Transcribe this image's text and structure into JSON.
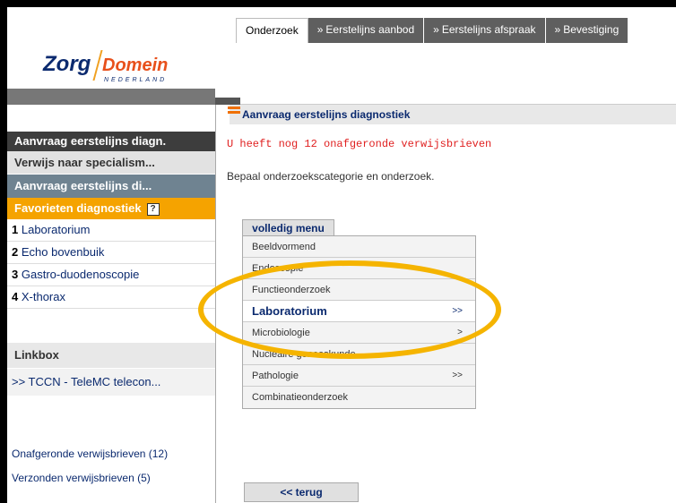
{
  "tabs": [
    {
      "label": "Onderzoek",
      "sep": ""
    },
    {
      "label": "Eerstelijns aanbod",
      "sep": "»"
    },
    {
      "label": "Eerstelijns afspraak",
      "sep": "»"
    },
    {
      "label": "Bevestiging",
      "sep": "»"
    }
  ],
  "logo": {
    "zorg": "Zorg",
    "domein": "Domein",
    "sub": "NEDERLAND"
  },
  "sidebar": {
    "header": "Aanvraag eerstelijns diagn.",
    "nav1": "Verwijs naar specialism...",
    "nav2": "Aanvraag eerstelijns di...",
    "favorites": {
      "label": "Favorieten diagnostiek",
      "help": "?"
    },
    "fav_items": [
      {
        "num": "1",
        "label": "Laboratorium"
      },
      {
        "num": "2",
        "label": "Echo bovenbuik"
      },
      {
        "num": "3",
        "label": "Gastro-duodenoscopie"
      },
      {
        "num": "4",
        "label": "X-thorax"
      }
    ],
    "linkbox_title": "Linkbox",
    "linkbox_item": ">> TCCN - TeleMC telecon...",
    "link_unfinished": "Onafgeronde verwijsbrieven (12)",
    "link_sent": "Verzonden verwijsbrieven (5)"
  },
  "main": {
    "title": "Aanvraag eerstelijns diagnostiek",
    "warning": "U heeft nog 12 onafgeronde verwijsbrieven",
    "instruction": "Bepaal onderzoekscategorie en onderzoek.",
    "menu_tab": "volledig menu",
    "menu_items": [
      {
        "label": "Beeldvormend",
        "arrow": ""
      },
      {
        "label": "Endoscopie",
        "arrow": ""
      },
      {
        "label": "Functieonderzoek",
        "arrow": ""
      },
      {
        "label": "Laboratorium",
        "arrow": ">>"
      },
      {
        "label": "Microbiologie",
        "arrow": ">"
      },
      {
        "label": "Nucleaire geneeskunde",
        "arrow": ""
      },
      {
        "label": "Pathologie",
        "arrow": ">>"
      },
      {
        "label": "Combinatieonderzoek",
        "arrow": ""
      }
    ],
    "back": "<< terug"
  },
  "colors": {
    "accent_orange": "#f5a300",
    "highlight_ellipse": "#f5b400",
    "warning": "#e02020",
    "navy": "#0b2a6f"
  }
}
